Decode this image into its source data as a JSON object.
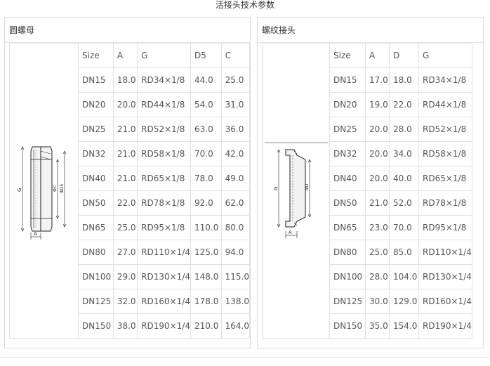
{
  "page_title": "活接头技术参数",
  "left": {
    "title": "圆螺母",
    "headers": [
      "Size",
      "A",
      "G",
      "D5",
      "C"
    ],
    "rows": [
      [
        "DN15",
        "18.0",
        "RD34×1/8",
        "44.0",
        "25.0"
      ],
      [
        "DN20",
        "20.0",
        "RD44×1/8",
        "54.0",
        "31.0"
      ],
      [
        "DN25",
        "21.0",
        "RD52×1/8",
        "63.0",
        "36.0"
      ],
      [
        "DN32",
        "21.0",
        "RD58×1/8",
        "70.0",
        "42.0"
      ],
      [
        "DN40",
        "21.0",
        "RD65×1/8",
        "78.0",
        "49.0"
      ],
      [
        "DN50",
        "22.0",
        "RD78×1/8",
        "92.0",
        "62.0"
      ],
      [
        "DN65",
        "25.0",
        "RD95×1/8",
        "110.0",
        "80.0"
      ],
      [
        "DN80",
        "27.0",
        "RD110×1/4",
        "125.0",
        "94.0"
      ],
      [
        "DN100",
        "29.0",
        "RD130×1/4",
        "148.0",
        "115.0"
      ],
      [
        "DN125",
        "32.0",
        "RD160×1/4",
        "178.0",
        "138.0"
      ],
      [
        "DN150",
        "38.0",
        "RD190×1/4",
        "210.0",
        "164.0"
      ]
    ],
    "drawing_labels": {
      "g": "G",
      "c": "ΦC",
      "d5": "ΦD5",
      "a": "A"
    }
  },
  "right": {
    "title": "螺纹接头",
    "headers": [
      "Size",
      "A",
      "D",
      "G"
    ],
    "rows": [
      [
        "DN15",
        "17.0",
        "18.0",
        "RD34×1/8"
      ],
      [
        "DN20",
        "19.0",
        "22.0",
        "RD44×1/8"
      ],
      [
        "DN25",
        "20.0",
        "28.0",
        "RD52×1/8"
      ],
      [
        "DN32",
        "20.0",
        "34.0",
        "RD58×1/8"
      ],
      [
        "DN40",
        "20.0",
        "40.0",
        "RD65×1/8"
      ],
      [
        "DN50",
        "21.0",
        "52.0",
        "RD78×1/8"
      ],
      [
        "DN65",
        "23.0",
        "70.0",
        "RD95×1/8"
      ],
      [
        "DN80",
        "25.0",
        "85.0",
        "RD110×1/4"
      ],
      [
        "DN100",
        "28.0",
        "104.0",
        "RD130×1/4"
      ],
      [
        "DN125",
        "30.0",
        "129.0",
        "RD160×1/4"
      ],
      [
        "DN150",
        "35.0",
        "154.0",
        "RD190×1/4"
      ]
    ],
    "drawing_labels": {
      "g": "G",
      "d": "ΦD",
      "a": "A"
    }
  }
}
